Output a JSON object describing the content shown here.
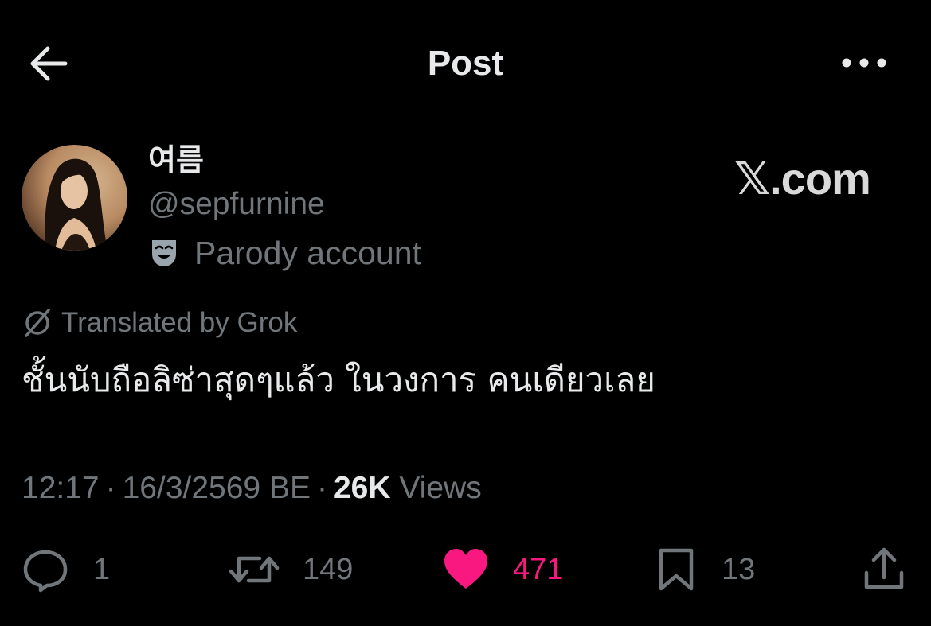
{
  "header": {
    "title": "Post",
    "back_icon": "arrow-left-icon",
    "more_icon": "more-horizontal-icon"
  },
  "post": {
    "author": {
      "display_name": "여름",
      "handle": "@sepfurnine",
      "label": "Parody account",
      "label_icon": "theater-mask-icon"
    },
    "watermark": "𝕏.com",
    "translation": {
      "label": "Translated by Grok",
      "icon": "grok-icon"
    },
    "text": "ชั้นนับถือลิซ่าสุดๆแล้ว ในวงการ คนเดียวเลย",
    "time": "12:17",
    "date": "16/3/2569 BE",
    "views_count": "26K",
    "views_label": "Views",
    "meta_separator": "·"
  },
  "actions": {
    "replies": "1",
    "reposts": "149",
    "likes": "471",
    "bookmarks": "13"
  },
  "colors": {
    "background": "#000000",
    "text_primary": "#e7e9ea",
    "text_secondary": "#71767b",
    "like_active": "#f91880",
    "divider": "#2f3336"
  }
}
